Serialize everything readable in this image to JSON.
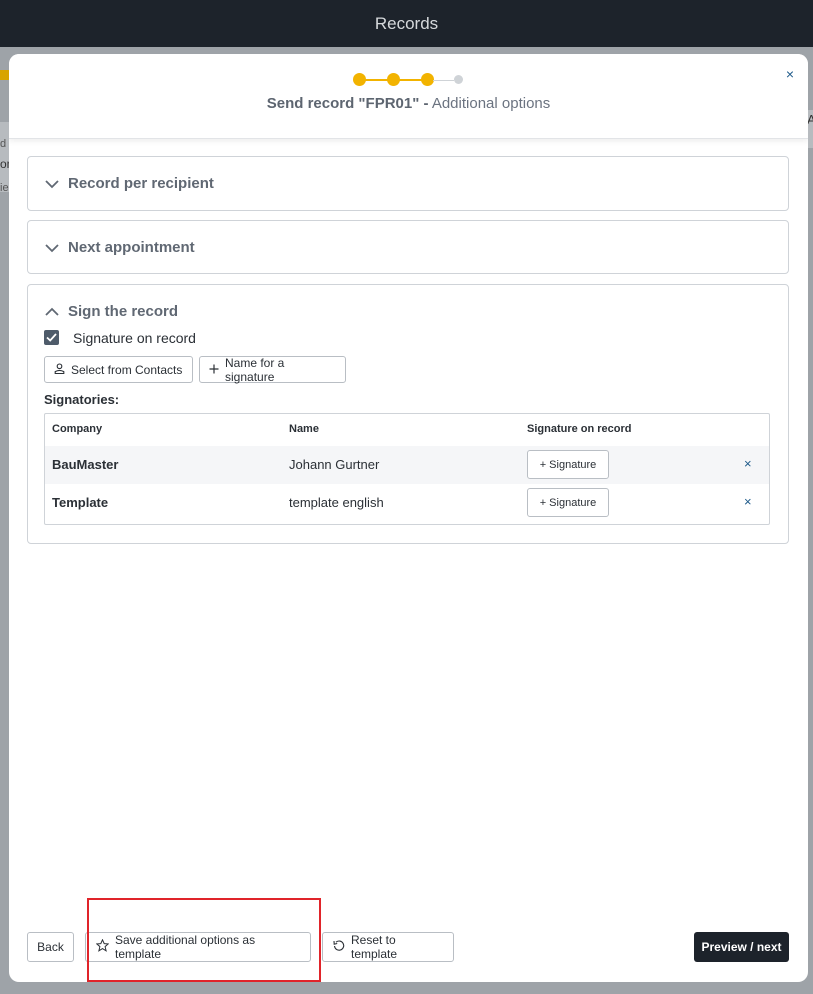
{
  "app": {
    "title": "Records"
  },
  "background": {
    "left_text_1": "d",
    "left_text_2": "on",
    "left_text_3": "ie",
    "right_text": "A"
  },
  "modal": {
    "title_strong": "Send record \"FPR01\" -",
    "title_rest": " Additional options",
    "close_label": "×",
    "stepper": {
      "current_step": 3,
      "total_steps": 4,
      "accent": "#f2b300"
    }
  },
  "sections": {
    "record_per_recipient": "Record per recipient",
    "next_appointment": "Next appointment",
    "sign_the_record": "Sign the record"
  },
  "sign": {
    "checkbox_label": "Signature on record",
    "checkbox_checked": true,
    "select_contacts_label": "Select from Contacts",
    "name_for_signature_label": "Name for a signature",
    "signatories_label": "Signatories:",
    "table": {
      "headers": [
        "Company",
        "Name",
        "Signature on record"
      ],
      "rows": [
        {
          "company": "BauMaster",
          "name": "Johann Gurtner",
          "signature_button": "+ Signature",
          "remove": "×"
        },
        {
          "company": "Template",
          "name": "template english",
          "signature_button": "+ Signature",
          "remove": "×"
        }
      ]
    }
  },
  "footer": {
    "back_label": "Back",
    "save_template_label": "Save additional options as template",
    "reset_template_label": "Reset to template",
    "preview_next_label": "Preview / next"
  },
  "colors": {
    "primary_dark": "#1d232b",
    "accent_yellow": "#f2b300",
    "highlight_red": "#e0242a",
    "link_blue": "#1e5a8a"
  }
}
